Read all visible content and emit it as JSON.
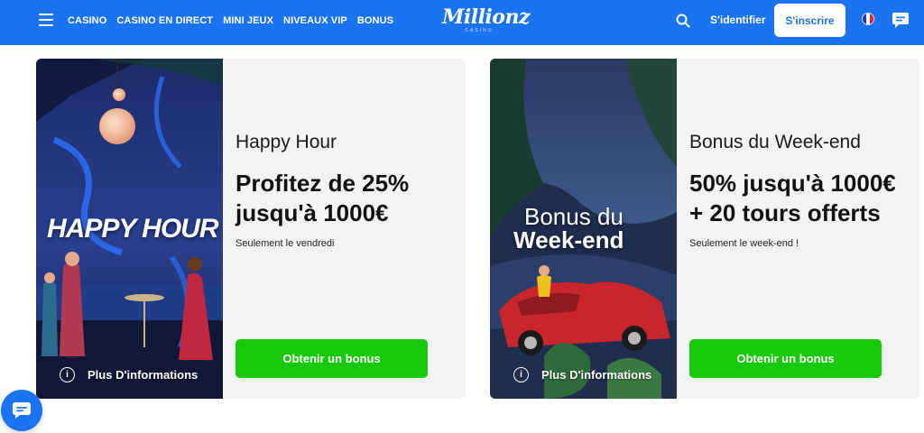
{
  "header": {
    "nav": [
      "CASINO",
      "CASINO EN DIRECT",
      "MINI JEUX",
      "NIVEAUX VIP",
      "BONUS"
    ],
    "logo_main": "Millionz",
    "logo_sub": "CASINO",
    "login_label": "S'identifier",
    "signup_label": "S'inscrire",
    "brand_color": "#1a73f0"
  },
  "cards": [
    {
      "image_text": "HAPPY HOUR",
      "title": "Happy Hour",
      "headline": "Profitez de 25% jusqu'à 1000€",
      "note": "Seulement le vendredi",
      "button_label": "Obtenir un bonus",
      "info_label": "Plus D'informations"
    },
    {
      "image_text_1": "Bonus du",
      "image_text_2": "Week-end",
      "title": "Bonus du Week-end",
      "headline": "50% jusqu'à 1000€ + 20 tours offerts",
      "note": "Seulement le week-end !",
      "button_label": "Obtenir un bonus",
      "info_label": "Plus D'informations"
    }
  ],
  "colors": {
    "button_green": "#17c90b",
    "card_bg": "#f3f3f3"
  }
}
